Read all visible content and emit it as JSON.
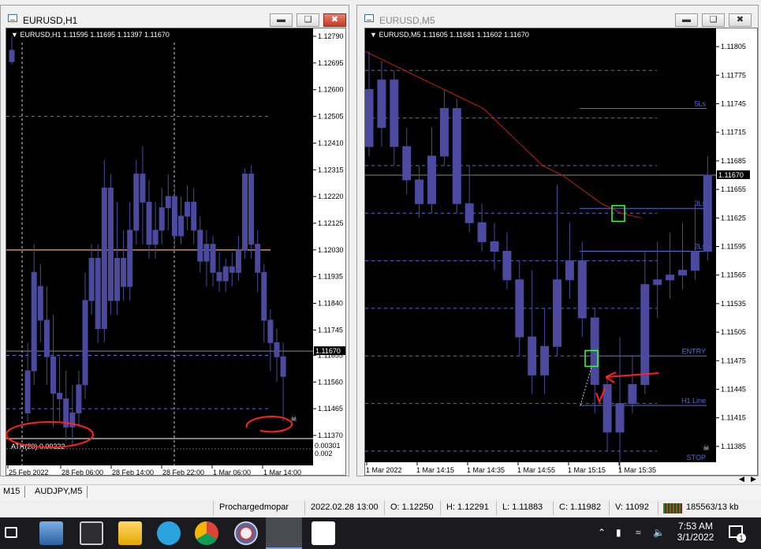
{
  "left_window": {
    "title": "EURUSD,H1",
    "header": "EURUSD,H1  1.11595 1.11695 1.11397 1.11670",
    "price_ticks": [
      "1.12790",
      "1.12695",
      "1.12600",
      "1.12505",
      "1.12410",
      "1.12315",
      "1.12220",
      "1.12125",
      "1.12030",
      "1.11935",
      "1.11840",
      "1.11745",
      "1.11655",
      "1.11560",
      "1.11465",
      "1.11370"
    ],
    "current_price": "1.11670",
    "time_ticks": [
      "25 Feb 2022",
      "28 Feb 06:00",
      "28 Feb 14:00",
      "28 Feb 22:00",
      "1 Mar 06:00",
      "1 Mar 14:00"
    ],
    "indicator_label": "ATR(20) 0.00222",
    "indicator_ticks": [
      "0.00301",
      "0.002"
    ]
  },
  "right_window": {
    "title": "EURUSD,M5",
    "header": "EURUSD,M5  1.11605 1.11681 1.11602 1.11670",
    "price_ticks": [
      "1.11805",
      "1.11775",
      "1.11745",
      "1.11715",
      "1.11685",
      "1.11655",
      "1.11625",
      "1.11595",
      "1.11565",
      "1.11535",
      "1.11505",
      "1.11475",
      "1.11445",
      "1.11415",
      "1.11385"
    ],
    "current_price": "1.11670",
    "time_ticks": [
      "1 Mar 2022",
      "1 Mar 14:15",
      "1 Mar 14:35",
      "1 Mar 14:55",
      "1 Mar 15:15",
      "1 Mar 15:35"
    ],
    "level_labels": {
      "ls5": "5Ls",
      "ls3": "3Ls",
      "ls2": "2Ls",
      "entry": "ENTRY",
      "h1": "H1 Line",
      "stop": "STOP"
    }
  },
  "tabs": [
    {
      "label": "M15"
    },
    {
      "label": "AUDJPY,M5"
    }
  ],
  "status": {
    "user": "Prochargedmopar",
    "datetime": "2022.02.28 13:00",
    "open": "O: 1.12250",
    "high": "H: 1.12291",
    "low": "L: 1.11883",
    "close": "C: 1.11982",
    "volume": "V: 11092",
    "traffic": "185563/13 kb"
  },
  "taskbar": {
    "time": "7:53 AM",
    "date": "3/1/2022",
    "notification_count": "1",
    "apps": [
      "task-view",
      "network-icon",
      "calculator",
      "file-explorer",
      "telegram",
      "chrome",
      "paint",
      "metatrader",
      "sticky-notes"
    ]
  },
  "colors": {
    "candle": "#4c4a9e",
    "ma_line": "#cc1a1a",
    "annotation": "#ff2020",
    "highlight": "#40ff40",
    "level": "#5a6ad8"
  }
}
